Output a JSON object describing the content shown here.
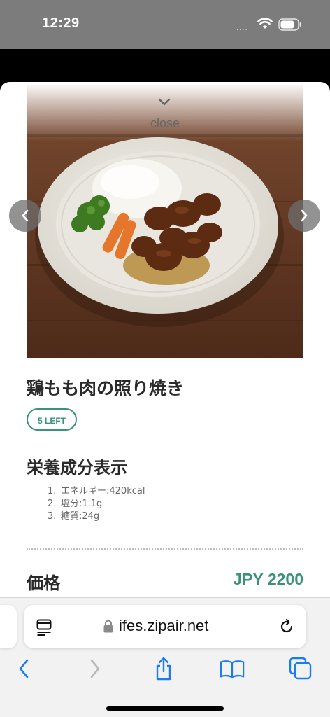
{
  "status_bar": {
    "time": "12:29",
    "signal": "····"
  },
  "modal": {
    "close_label": "close"
  },
  "dish": {
    "name": "鶏もも肉の照り焼き",
    "stock_badge": "5 LEFT",
    "nutrition_heading": "栄養成分表示",
    "nutrition": [
      {
        "num": "1.",
        "text": "エネルギー:420kcal"
      },
      {
        "num": "2.",
        "text": "塩分:1.1g"
      },
      {
        "num": "3.",
        "text": "糖質:24g"
      }
    ],
    "price_label": "価格",
    "price": "JPY 2200"
  },
  "browser": {
    "url": "ifes.zipair.net"
  },
  "colors": {
    "accent": "#3a9378",
    "status_bar": "#7c7c7c",
    "ios_blue": "#1a7cf5"
  },
  "icons": [
    "wifi-icon",
    "battery-icon",
    "chevron-down-icon",
    "chevron-left-icon",
    "chevron-right-icon",
    "reader-icon",
    "lock-icon",
    "reload-icon",
    "back-icon",
    "forward-icon",
    "share-icon",
    "bookmarks-icon",
    "tabs-icon"
  ]
}
